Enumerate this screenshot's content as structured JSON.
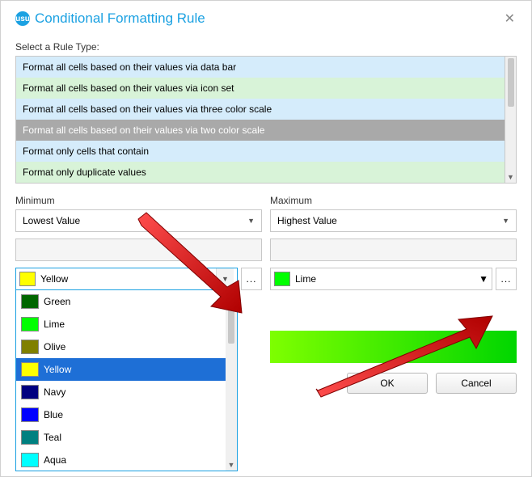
{
  "window": {
    "title": "Conditional Formatting Rule"
  },
  "section": {
    "rule_type_label": "Select a Rule Type:"
  },
  "rule_types": [
    "Format all cells based on their values via data bar",
    "Format all cells based on their values via icon set",
    "Format all cells based on their values via three color scale",
    "Format all cells based on their values via two color scale",
    "Format only cells that contain",
    "Format only duplicate values"
  ],
  "rule_types_selected_index": 3,
  "minimum": {
    "label": "Minimum",
    "value_type": "Lowest Value",
    "color_name": "Yellow",
    "color_hex": "#ffff00"
  },
  "maximum": {
    "label": "Maximum",
    "value_type": "Highest Value",
    "color_name": "Lime",
    "color_hex": "#00ff00"
  },
  "color_options": [
    {
      "name": "Green",
      "hex": "#006600"
    },
    {
      "name": "Lime",
      "hex": "#00ff00"
    },
    {
      "name": "Olive",
      "hex": "#808000"
    },
    {
      "name": "Yellow",
      "hex": "#ffff00"
    },
    {
      "name": "Navy",
      "hex": "#000080"
    },
    {
      "name": "Blue",
      "hex": "#0000ff"
    },
    {
      "name": "Teal",
      "hex": "#008080"
    },
    {
      "name": "Aqua",
      "hex": "#00ffff"
    }
  ],
  "color_dropdown_selected_index": 3,
  "buttons": {
    "ok": "OK",
    "cancel": "Cancel"
  },
  "more": "..."
}
